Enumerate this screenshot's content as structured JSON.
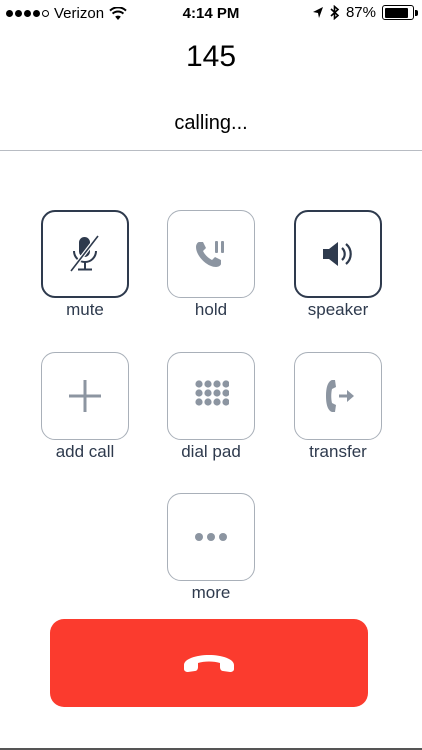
{
  "status_bar": {
    "carrier": "Verizon",
    "time": "4:14 PM",
    "battery_percent": "87%",
    "battery_level": 0.87,
    "signal_bars": 4,
    "signal_max": 5,
    "icons": [
      "wifi-icon",
      "location-arrow-icon",
      "bluetooth-icon",
      "battery-icon"
    ]
  },
  "call": {
    "number": "145",
    "state": "calling..."
  },
  "controls": {
    "mute": {
      "label": "mute",
      "icon": "microphone-muted-icon",
      "active": true
    },
    "hold": {
      "label": "hold",
      "icon": "phone-hold-icon",
      "active": false
    },
    "speaker": {
      "label": "speaker",
      "icon": "speaker-icon",
      "active": true
    },
    "add_call": {
      "label": "add call",
      "icon": "plus-icon",
      "active": false
    },
    "dial_pad": {
      "label": "dial pad",
      "icon": "keypad-icon",
      "active": false
    },
    "transfer": {
      "label": "transfer",
      "icon": "phone-transfer-icon",
      "active": false
    },
    "more": {
      "label": "more",
      "icon": "ellipsis-icon",
      "active": false
    }
  },
  "end_call": {
    "icon": "hang-up-phone-icon"
  },
  "colors": {
    "end_call": "#fb3b2e",
    "active_border": "#2e3a4d",
    "inactive_border": "#a9b0b9",
    "icon_dark": "#2e3a4d",
    "icon_muted": "#8c95a1"
  }
}
